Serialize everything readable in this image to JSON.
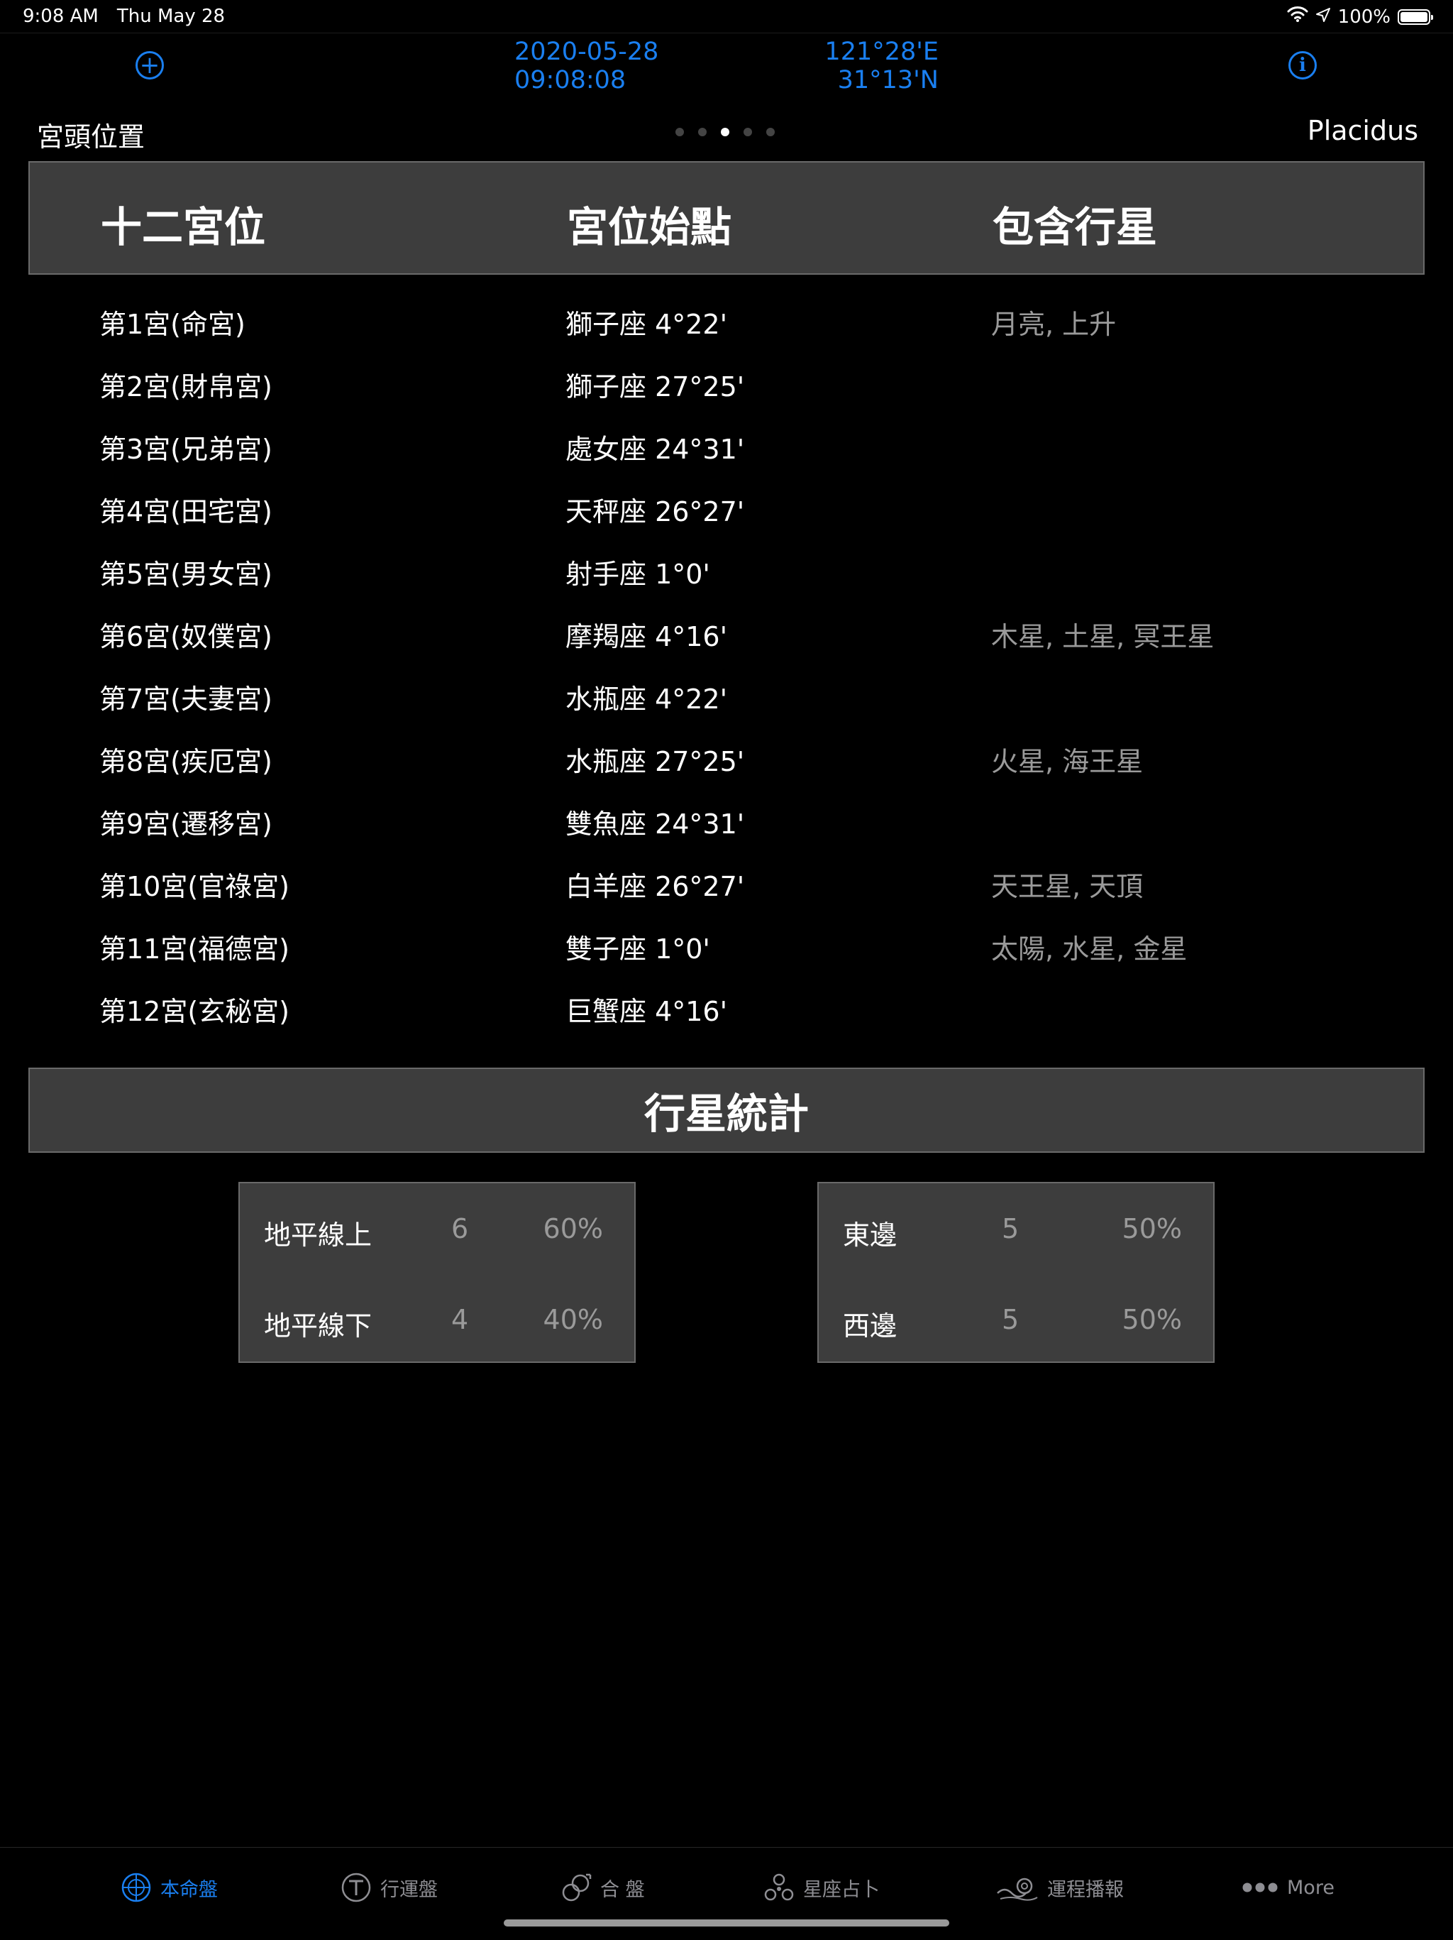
{
  "status_bar": {
    "time": "9:08 AM",
    "date": "Thu May 28",
    "battery": "100%"
  },
  "nav": {
    "add_icon": "plus-circle-icon",
    "info_icon": "info-circle-icon",
    "date": "2020-05-28",
    "time": "09:08:08",
    "longitude": "121°28'E",
    "latitude": "31°13'N"
  },
  "page": {
    "title": "宮頭位置",
    "method": "Placidus",
    "page_count": 5,
    "active_page": 2
  },
  "house_table": {
    "headers": [
      "十二宮位",
      "宮位始點",
      "包含行星"
    ],
    "rows": [
      {
        "house": "第1宮(命宮)",
        "cusp": "獅子座 4°22'",
        "planets": "月亮, 上升"
      },
      {
        "house": "第2宮(財帛宮)",
        "cusp": "獅子座 27°25'",
        "planets": ""
      },
      {
        "house": "第3宮(兄弟宮)",
        "cusp": "處女座 24°31'",
        "planets": ""
      },
      {
        "house": "第4宮(田宅宮)",
        "cusp": "天秤座 26°27'",
        "planets": ""
      },
      {
        "house": "第5宮(男女宮)",
        "cusp": "射手座 1°0'",
        "planets": ""
      },
      {
        "house": "第6宮(奴僕宮)",
        "cusp": "摩羯座 4°16'",
        "planets": "木星, 土星, 冥王星"
      },
      {
        "house": "第7宮(夫妻宮)",
        "cusp": "水瓶座 4°22'",
        "planets": ""
      },
      {
        "house": "第8宮(疾厄宮)",
        "cusp": "水瓶座 27°25'",
        "planets": "火星, 海王星"
      },
      {
        "house": "第9宮(遷移宮)",
        "cusp": "雙魚座 24°31'",
        "planets": ""
      },
      {
        "house": "第10宮(官祿宮)",
        "cusp": "白羊座 26°27'",
        "planets": "天王星, 天頂"
      },
      {
        "house": "第11宮(福德宮)",
        "cusp": "雙子座 1°0'",
        "planets": "太陽, 水星, 金星"
      },
      {
        "house": "第12宮(玄秘宮)",
        "cusp": "巨蟹座 4°16'",
        "planets": ""
      }
    ]
  },
  "stats": {
    "title": "行星統計",
    "horizon": [
      {
        "label": "地平線上",
        "count": "6",
        "percent": "60%"
      },
      {
        "label": "地平線下",
        "count": "4",
        "percent": "40%"
      }
    ],
    "meridian": [
      {
        "label": "東邊",
        "count": "5",
        "percent": "50%"
      },
      {
        "label": "西邊",
        "count": "5",
        "percent": "50%"
      }
    ]
  },
  "tabbar": {
    "tabs": [
      {
        "label": "本命盤",
        "icon": "natal-chart-icon",
        "active": true
      },
      {
        "label": "行運盤",
        "icon": "transit-t-icon",
        "active": false
      },
      {
        "label": "合 盤",
        "icon": "synastry-icon",
        "active": false
      },
      {
        "label": "星座占卜",
        "icon": "divination-icon",
        "active": false
      },
      {
        "label": "運程播報",
        "icon": "horoscope-wave-icon",
        "active": false
      },
      {
        "label": "More",
        "icon": "more-dots-icon",
        "active": false
      }
    ]
  },
  "colors": {
    "accent": "#1a7ff0",
    "background": "#000000",
    "panel": "#3d3d3d",
    "secondary_text": "#9a9a9a"
  }
}
